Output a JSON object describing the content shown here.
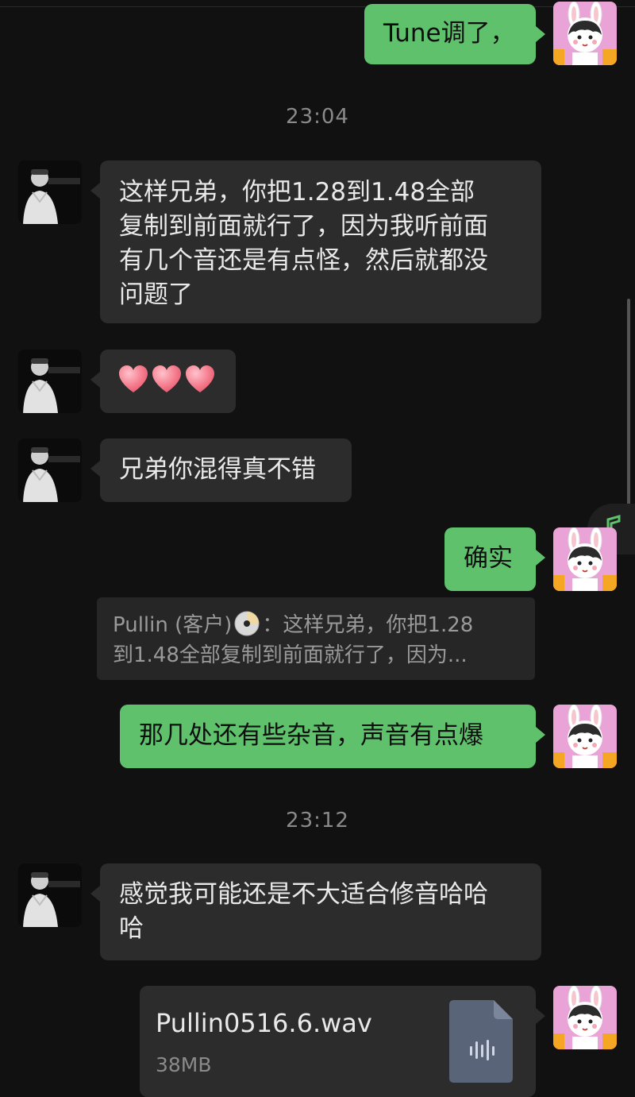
{
  "messages": {
    "m1_out": "Tune调了，",
    "time1": "23:04",
    "m2_in": [
      "这样兄弟，你把1.28到1.48全部",
      "复制到前面就行了，因为我听前面",
      "有几个音还是有点怪，然后就都没",
      "问题了"
    ],
    "m3_in_emoji": "❤️❤️❤️",
    "m4_in": "兄弟你混得真不错",
    "m5_out": "确实",
    "quote": {
      "author": "Pullin (客户)",
      "line1_rest": "：这样兄弟，你把1.28",
      "line2": "到1.48全部复制到前面就行了，因为..."
    },
    "m6_out": "那几处还有些杂音，声音有点爆",
    "time2": "23:12",
    "m7_in": [
      "感觉我可能还是不大适合修音哈哈",
      "哈"
    ],
    "file": {
      "name": "Pullin0516.6.wav",
      "size": "38MB"
    }
  },
  "colors": {
    "background": "#111111",
    "incoming_bubble": "#2c2c2c",
    "outgoing_bubble": "#5fc16c",
    "timestamp": "#8a8a8a"
  },
  "icons": {
    "contact_avatar": "person-photo-avatar",
    "self_avatar": "cartoon-girl-bunny-avatar",
    "quote_emoji": "disc-icon",
    "file_type": "audio-file-icon",
    "floating": "music-note-icon"
  }
}
